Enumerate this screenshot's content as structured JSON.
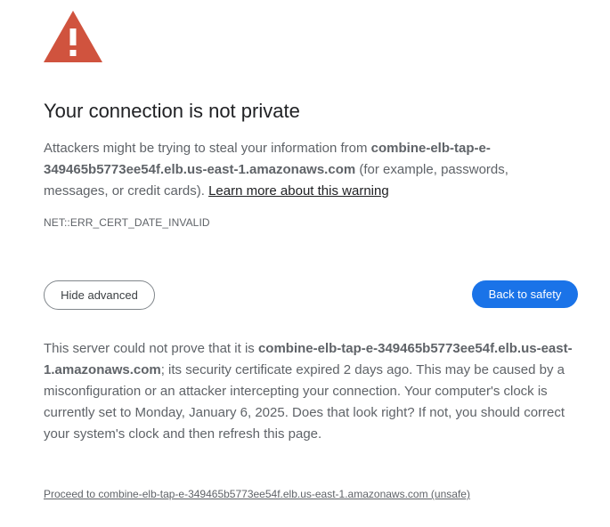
{
  "colors": {
    "warning_red": "#d0533e",
    "primary_blue": "#1a73e8",
    "title_text": "#202124",
    "body_text": "#5f6368"
  },
  "icon": "warning-triangle-icon",
  "title": "Your connection is not private",
  "main_message": {
    "prefix": "Attackers might be trying to steal your information from ",
    "host": "combine-elb-tap-e-349465b5773ee54f.elb.us-east-1.amazonaws.com",
    "suffix": " (for example, passwords, messages, or credit cards). ",
    "learn_more": "Learn more about this warning"
  },
  "error_code": "NET::ERR_CERT_DATE_INVALID",
  "buttons": {
    "hide_advanced": "Hide advanced",
    "back_to_safety": "Back to safety"
  },
  "details": {
    "prefix": "This server could not prove that it is ",
    "host": "combine-elb-tap-e-349465b5773ee54f.elb.us-east-1.amazonaws.com",
    "suffix": "; its security certificate expired 2 days ago. This may be caused by a misconfiguration or an attacker intercepting your connection. Your computer's clock is currently set to Monday, January 6, 2025. Does that look right? If not, you should correct your system's clock and then refresh this page."
  },
  "proceed_link": "Proceed to combine-elb-tap-e-349465b5773ee54f.elb.us-east-1.amazonaws.com (unsafe)"
}
